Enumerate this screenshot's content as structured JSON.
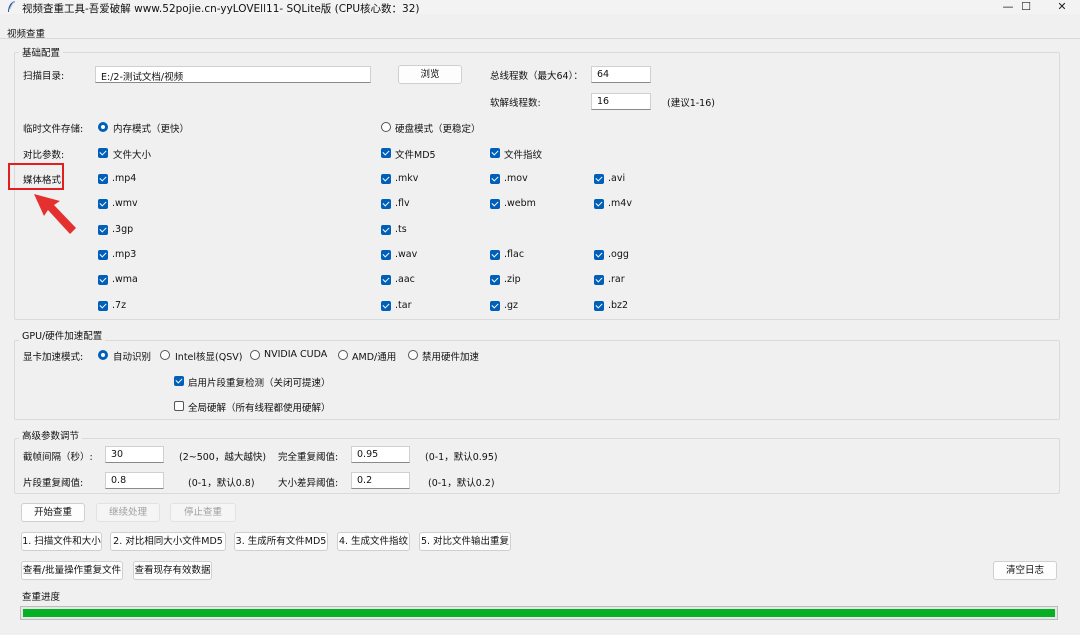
{
  "window": {
    "title": "视频查重工具-吾爱破解 www.52pojie.cn-yyLOVEll11- SQLite版 (CPU核心数：32)",
    "min_icon": "minimize-icon",
    "max_icon": "maximize-icon",
    "close_icon": "close-icon",
    "min_glyph": "—",
    "max_glyph": "☐",
    "close_glyph": "✕"
  },
  "tab": {
    "label": "视频查重"
  },
  "basic": {
    "group_label": "基础配置",
    "scan_dir_label": "扫描目录:",
    "scan_dir_value": "E:/2-测试文档/视频",
    "browse_label": "浏览",
    "total_threads_label": "总线程数（最大64）：",
    "total_threads_value": "64",
    "decode_threads_label": "软解线程数:",
    "decode_threads_value": "16",
    "decode_hint": "(建议1-16)",
    "temp_storage_label": "临时文件存储:",
    "memory_mode_label": "内存模式（更快）",
    "memory_mode_selected": true,
    "disk_mode_label": "硬盘模式（更稳定）",
    "disk_mode_selected": false,
    "compare_label": "对比参数:",
    "compare_size_label": "文件大小",
    "compare_md5_label": "文件MD5",
    "compare_fingerprint_label": "文件指纹",
    "media_label": "媒体格式:",
    "formats": [
      [
        ".mp4",
        ".mkv",
        ".mov",
        ".avi"
      ],
      [
        ".wmv",
        ".flv",
        ".webm",
        ".m4v"
      ],
      [
        ".3gp",
        ".ts"
      ],
      [
        ".mp3",
        ".wav",
        ".flac",
        ".ogg"
      ],
      [
        ".wma",
        ".aac",
        ".zip",
        ".rar"
      ],
      [
        ".7z",
        ".tar",
        ".gz",
        ".bz2"
      ]
    ]
  },
  "gpu": {
    "group_label": "GPU/硬件加速配置",
    "mode_label": "显卡加速模式:",
    "options": [
      "自动识别",
      "Intel核显(QSV)",
      "NVIDIA CUDA",
      "AMD/通用",
      "禁用硬件加速"
    ],
    "selected": "自动识别",
    "segment_label": "启用片段重复检测（关闭可提速）",
    "segment_checked": true,
    "global_hw_label": "全局硬解（所有线程都使用硬解）",
    "global_hw_checked": false
  },
  "advanced": {
    "group_label": "高级参数调节",
    "frame_interval_label": "截帧间隔（秒）:",
    "frame_interval_value": "30",
    "frame_interval_hint": "(2~500，越大越快)",
    "full_dup_label": "完全重复阈值:",
    "full_dup_value": "0.95",
    "full_dup_hint": "(0-1，默认0.95)",
    "segment_dup_label": "片段重复阈值:",
    "segment_dup_value": "0.8",
    "segment_dup_hint": "(0-1，默认0.8)",
    "size_diff_label": "大小差异阈值:",
    "size_diff_value": "0.2",
    "size_diff_hint": "(0-1，默认0.2)"
  },
  "actions": {
    "start": "开始查重",
    "resume": "继续处理",
    "stop": "停止查重",
    "steps": [
      "1. 扫描文件和大小",
      "2. 对比相同大小文件MD5",
      "3. 生成所有文件MD5",
      "4. 生成文件指纹",
      "5. 对比文件输出重复"
    ],
    "view_dup": "查看/批量操作重复文件",
    "view_valid": "查看现存有效数据",
    "clear_log": "清空日志"
  },
  "progress": {
    "label": "查重进度",
    "fraction": 1.0,
    "color": "#06b025"
  },
  "annotation": {
    "highlight_color": "#e02020"
  }
}
